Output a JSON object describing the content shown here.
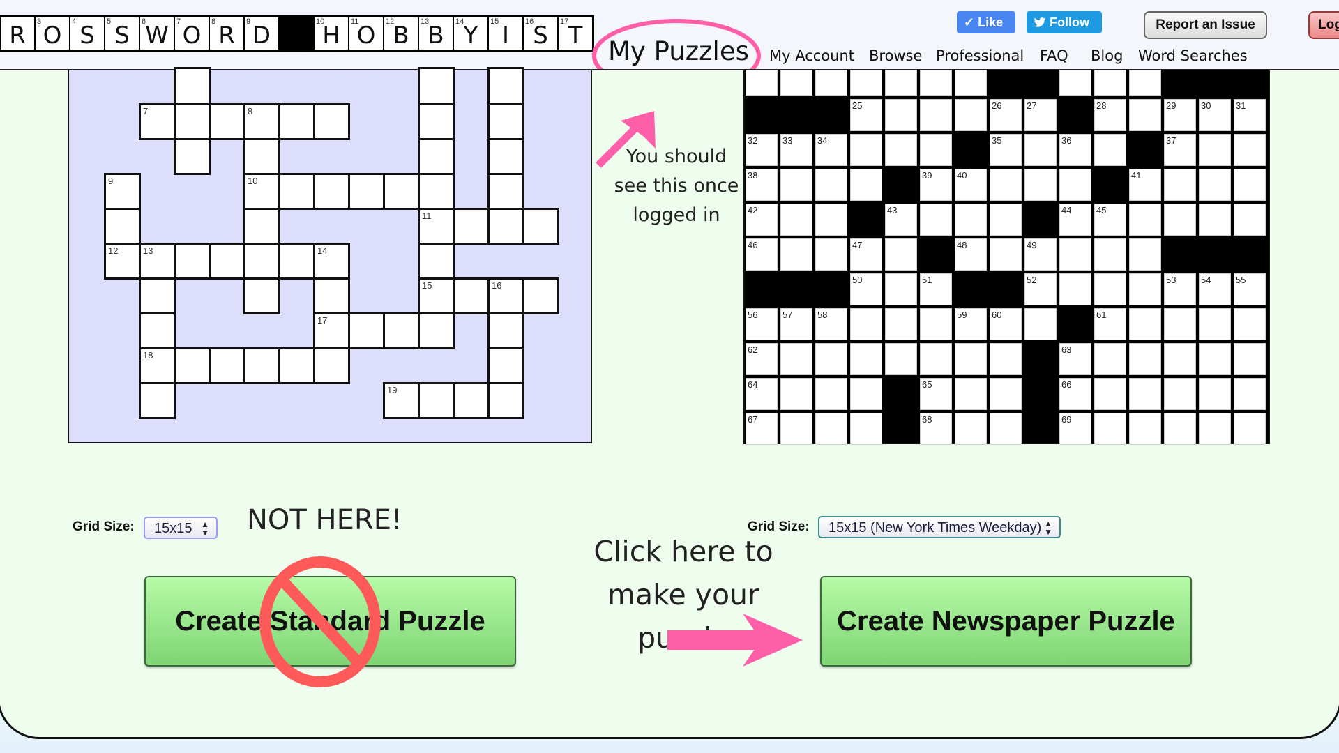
{
  "header": {
    "logo_tiles": [
      {
        "num": "",
        "letter": "R"
      },
      {
        "num": "3",
        "letter": "O"
      },
      {
        "num": "4",
        "letter": "S"
      },
      {
        "num": "5",
        "letter": "S"
      },
      {
        "num": "6",
        "letter": "W"
      },
      {
        "num": "7",
        "letter": "O"
      },
      {
        "num": "8",
        "letter": "R"
      },
      {
        "num": "9",
        "letter": "D"
      },
      {
        "num": "",
        "letter": "",
        "black": true
      },
      {
        "num": "10",
        "letter": "H"
      },
      {
        "num": "11",
        "letter": "O"
      },
      {
        "num": "12",
        "letter": "B"
      },
      {
        "num": "13",
        "letter": "B"
      },
      {
        "num": "14",
        "letter": "Y"
      },
      {
        "num": "15",
        "letter": "I"
      },
      {
        "num": "16",
        "letter": "S"
      },
      {
        "num": "17",
        "letter": "T"
      }
    ],
    "nav": {
      "my_puzzles": "My Puzzles",
      "my_account": "My Account",
      "browse": "Browse",
      "professional": "Professional",
      "faq": "FAQ",
      "blog": "Blog",
      "word_searches": "Word Searches"
    },
    "social": {
      "like": "Like",
      "follow": "Follow",
      "like_color": "#4a86f2",
      "follow_color": "#1d9ae2"
    },
    "report_issue": "Report an Issue",
    "login": "Log"
  },
  "annotations": {
    "logged_in_note": [
      "You should",
      "see this once",
      "logged in"
    ],
    "not_here": "NOT HERE!",
    "click_here": [
      "Click here to",
      "make your puzzle"
    ],
    "accent_color": "#ff5fa8",
    "prohibit_color": "#ff5a5a"
  },
  "standard": {
    "grid_size_label": "Grid Size:",
    "grid_size_value": "15x15",
    "button_label": "Create Standard Puzzle",
    "cells": [
      [
        0,
        2,
        ""
      ],
      [
        0,
        9,
        ""
      ],
      [
        0,
        11,
        ""
      ],
      [
        1,
        1,
        "7"
      ],
      [
        1,
        2,
        ""
      ],
      [
        1,
        3,
        ""
      ],
      [
        1,
        4,
        "8"
      ],
      [
        1,
        5,
        ""
      ],
      [
        1,
        6,
        ""
      ],
      [
        1,
        9,
        ""
      ],
      [
        1,
        11,
        ""
      ],
      [
        2,
        2,
        ""
      ],
      [
        2,
        4,
        ""
      ],
      [
        2,
        9,
        ""
      ],
      [
        2,
        11,
        ""
      ],
      [
        3,
        0,
        "9"
      ],
      [
        3,
        4,
        "10"
      ],
      [
        3,
        5,
        ""
      ],
      [
        3,
        6,
        ""
      ],
      [
        3,
        7,
        ""
      ],
      [
        3,
        8,
        ""
      ],
      [
        3,
        9,
        ""
      ],
      [
        3,
        11,
        ""
      ],
      [
        4,
        0,
        ""
      ],
      [
        4,
        4,
        ""
      ],
      [
        4,
        9,
        "11"
      ],
      [
        4,
        10,
        ""
      ],
      [
        4,
        11,
        ""
      ],
      [
        4,
        12,
        ""
      ],
      [
        5,
        0,
        "12"
      ],
      [
        5,
        1,
        "13"
      ],
      [
        5,
        2,
        ""
      ],
      [
        5,
        3,
        ""
      ],
      [
        5,
        4,
        ""
      ],
      [
        5,
        5,
        ""
      ],
      [
        5,
        6,
        "14"
      ],
      [
        5,
        9,
        ""
      ],
      [
        6,
        1,
        ""
      ],
      [
        6,
        4,
        ""
      ],
      [
        6,
        6,
        ""
      ],
      [
        6,
        9,
        "15"
      ],
      [
        6,
        10,
        ""
      ],
      [
        6,
        11,
        "16"
      ],
      [
        6,
        12,
        ""
      ],
      [
        7,
        1,
        ""
      ],
      [
        7,
        6,
        "17"
      ],
      [
        7,
        7,
        ""
      ],
      [
        7,
        8,
        ""
      ],
      [
        7,
        9,
        ""
      ],
      [
        7,
        11,
        ""
      ],
      [
        8,
        1,
        "18"
      ],
      [
        8,
        2,
        ""
      ],
      [
        8,
        3,
        ""
      ],
      [
        8,
        4,
        ""
      ],
      [
        8,
        5,
        ""
      ],
      [
        8,
        6,
        ""
      ],
      [
        8,
        11,
        ""
      ],
      [
        9,
        1,
        ""
      ],
      [
        9,
        8,
        "19"
      ],
      [
        9,
        9,
        ""
      ],
      [
        9,
        10,
        ""
      ],
      [
        9,
        11,
        ""
      ]
    ]
  },
  "newspaper": {
    "grid_size_label": "Grid Size:",
    "grid_size_value": "15x15 (New York Times Weekday)",
    "button_label": "Create Newspaper Puzzle",
    "rows": [
      [
        "",
        "",
        "",
        "",
        "",
        "",
        "",
        "#",
        "#",
        "",
        "",
        "",
        "#",
        "#",
        "#"
      ],
      [
        "#",
        "#",
        "#",
        "25",
        "",
        "",
        "",
        "26",
        "27",
        "#",
        "28",
        "",
        "29",
        "30",
        "31"
      ],
      [
        "32",
        "33",
        "34",
        "",
        "",
        "",
        "#",
        "35",
        "",
        "36",
        "",
        "#",
        "37",
        "",
        ""
      ],
      [
        "38",
        "",
        "",
        "",
        "#",
        "39",
        "40",
        "",
        "",
        "",
        "#",
        "41",
        "",
        "",
        ""
      ],
      [
        "42",
        "",
        "",
        "#",
        "43",
        "",
        "",
        "",
        "#",
        "44",
        "45",
        "",
        "",
        "",
        ""
      ],
      [
        "46",
        "",
        "",
        "47",
        "",
        "#",
        "48",
        "",
        "49",
        "",
        "",
        "",
        "#",
        "#",
        "#"
      ],
      [
        "#",
        "#",
        "#",
        "50",
        "",
        "51",
        "#",
        "#",
        "52",
        "",
        "",
        "",
        "53",
        "54",
        "55"
      ],
      [
        "56",
        "57",
        "58",
        "",
        "",
        "",
        "59",
        "60",
        "",
        "#",
        "61",
        "",
        "",
        "",
        ""
      ],
      [
        "62",
        "",
        "",
        "",
        "",
        "",
        "",
        "",
        "#",
        "63",
        "",
        "",
        "",
        "",
        ""
      ],
      [
        "64",
        "",
        "",
        "",
        "#",
        "65",
        "",
        "",
        "#",
        "66",
        "",
        "",
        "",
        "",
        ""
      ],
      [
        "67",
        "",
        "",
        "",
        "#",
        "68",
        "",
        "",
        "#",
        "69",
        "",
        "",
        "",
        "",
        ""
      ]
    ]
  }
}
